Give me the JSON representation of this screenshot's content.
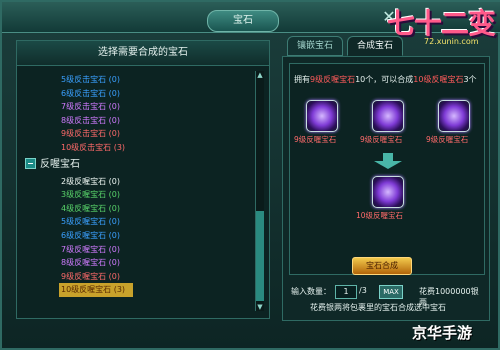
{
  "window": {
    "title": "宝石",
    "logo": "七十二变",
    "logo_url": "72.xunin.com"
  },
  "left_panel": {
    "header": "选择需要合成的宝石",
    "items_top": [
      {
        "label": "5级反击宝石 (0)",
        "color": "#3aa0ff"
      },
      {
        "label": "6级反击宝石 (0)",
        "color": "#3aa0ff"
      },
      {
        "label": "7级反击宝石 (0)",
        "color": "#d07bff"
      },
      {
        "label": "8级反击宝石 (0)",
        "color": "#d07bff"
      },
      {
        "label": "9级反击宝石 (0)",
        "color": "#ff6a6a"
      },
      {
        "label": "10级反击宝石 (3)",
        "color": "#ff6a6a"
      }
    ],
    "category": "反喔宝石",
    "items_bottom": [
      {
        "label": "2级反喔宝石 (0)",
        "color": "#eef7f3"
      },
      {
        "label": "3级反喔宝石 (0)",
        "color": "#59d46a"
      },
      {
        "label": "4级反喔宝石 (0)",
        "color": "#59d46a"
      },
      {
        "label": "5级反喔宝石 (0)",
        "color": "#3aa0ff"
      },
      {
        "label": "6级反喔宝石 (0)",
        "color": "#3aa0ff"
      },
      {
        "label": "7级反喔宝石 (0)",
        "color": "#d07bff"
      },
      {
        "label": "8级反喔宝石 (0)",
        "color": "#d07bff"
      },
      {
        "label": "9级反喔宝石 (0)",
        "color": "#ff6a6a"
      },
      {
        "label": "10级反喔宝石 (3)",
        "color": "#ff6a6a",
        "selected": true
      }
    ]
  },
  "tabs": [
    "镶嵌宝石",
    "合成宝石"
  ],
  "synthesis": {
    "prefix": "拥有",
    "owned_item": "9级反喔宝石",
    "owned_count": "10个，可以合成",
    "result_item": "10级反喔宝石",
    "result_count": "3个",
    "inputs": [
      "9级反喔宝石",
      "9级反喔宝石",
      "9级反喔宝石"
    ],
    "output": "10级反喔宝石",
    "qty_label": "输入数量：",
    "qty_value": "1",
    "qty_max": "/3",
    "max_btn": "MAX",
    "fee": "花费1000000银两",
    "action": "宝石合成"
  },
  "note": "花费银两将包裹里的宝石合成选中宝石",
  "watermark": "京华手游"
}
